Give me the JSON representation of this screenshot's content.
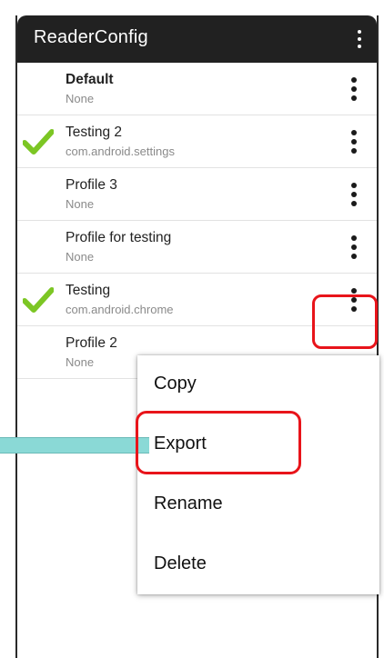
{
  "app_bar": {
    "title": "ReaderConfig",
    "overflow_icon": "more-vert-icon"
  },
  "profiles": [
    {
      "name": "Default",
      "package": "None",
      "bold": true,
      "checked": false
    },
    {
      "name": "Testing 2",
      "package": "com.android.settings",
      "bold": false,
      "checked": true
    },
    {
      "name": "Profile 3",
      "package": "None",
      "bold": false,
      "checked": false
    },
    {
      "name": "Profile for testing",
      "package": "None",
      "bold": false,
      "checked": false
    },
    {
      "name": "Testing",
      "package": "com.android.chrome",
      "bold": false,
      "checked": true
    },
    {
      "name": "Profile 2",
      "package": "None",
      "bold": false,
      "checked": false
    }
  ],
  "context_menu": {
    "items": [
      "Copy",
      "Export",
      "Rename",
      "Delete"
    ]
  },
  "colors": {
    "app_bar_bg": "#212121",
    "check_green": "#7cc624",
    "highlight_red": "#e8141a",
    "pointer_teal": "#8ad9d6"
  }
}
